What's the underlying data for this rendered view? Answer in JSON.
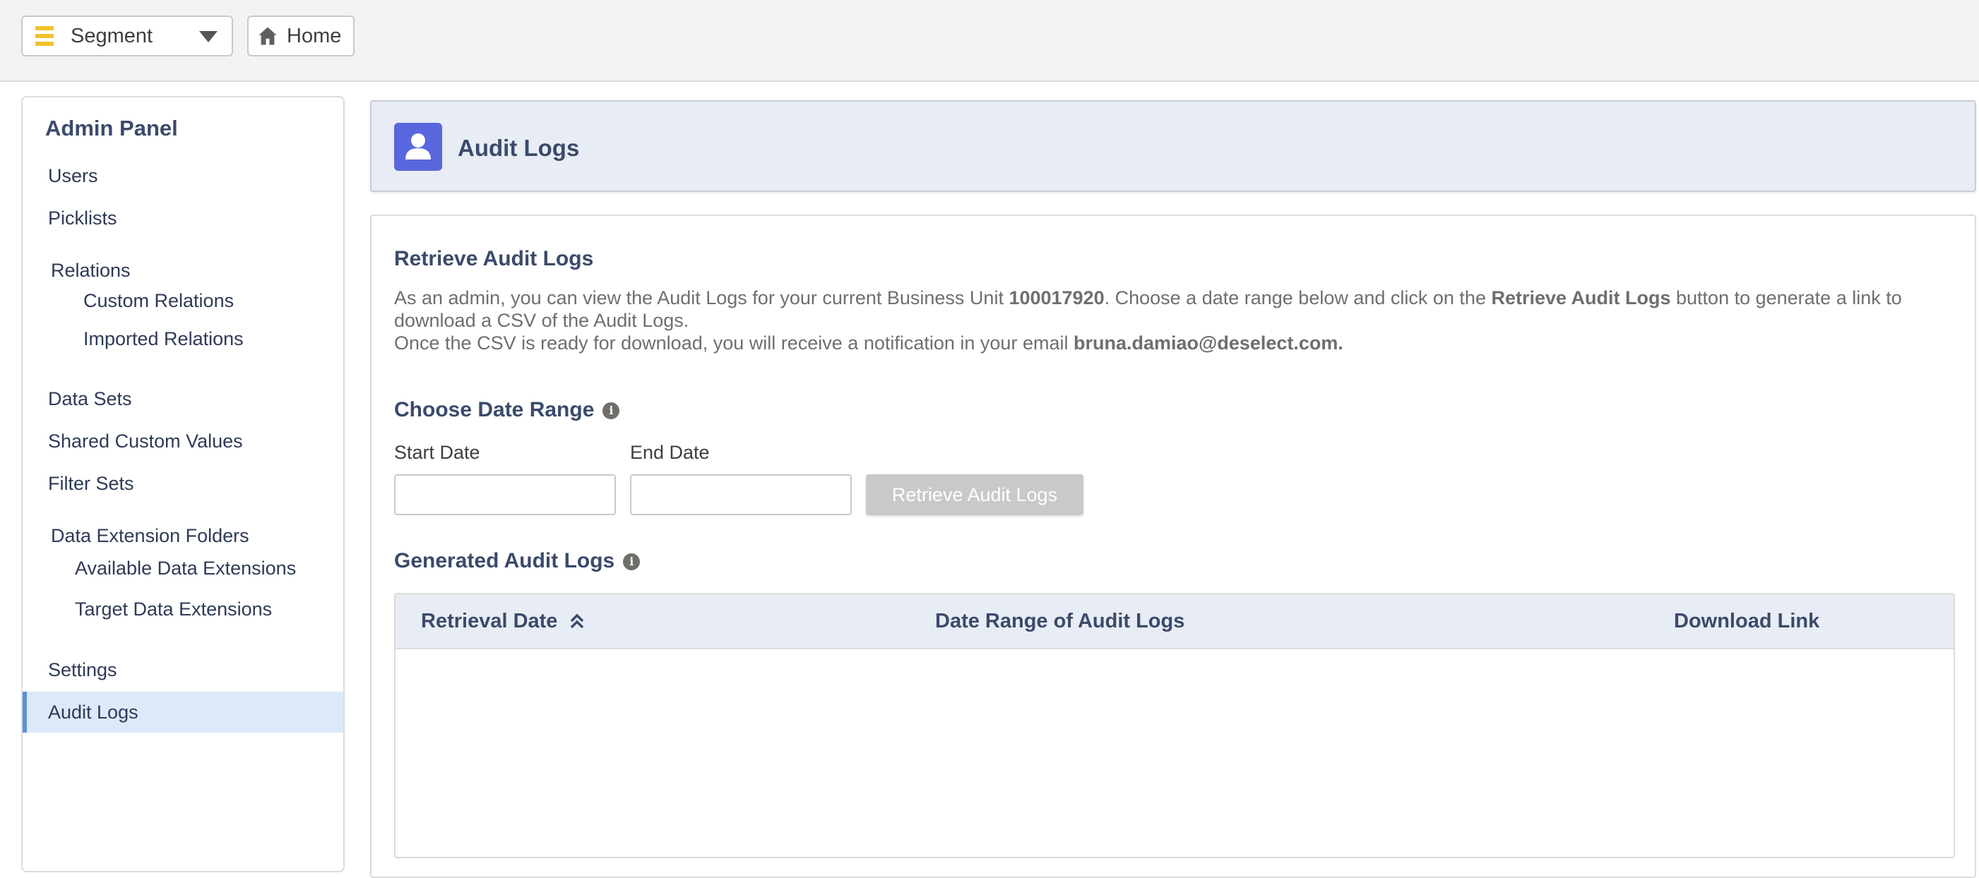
{
  "topbar": {
    "segment_label": "Segment",
    "home_label": "Home"
  },
  "sidebar": {
    "title": "Admin Panel",
    "items": [
      {
        "label": "Users"
      },
      {
        "label": "Picklists"
      },
      {
        "label": "Relations"
      },
      {
        "label": "Custom Relations"
      },
      {
        "label": "Imported Relations"
      },
      {
        "label": "Data Sets"
      },
      {
        "label": "Shared Custom Values"
      },
      {
        "label": "Filter Sets"
      },
      {
        "label": "Data Extension Folders"
      },
      {
        "label": "Available Data Extensions"
      },
      {
        "label": "Target Data Extensions"
      },
      {
        "label": "Settings"
      },
      {
        "label": "Audit Logs"
      }
    ]
  },
  "header": {
    "title": "Audit Logs",
    "icon": "user-icon"
  },
  "content": {
    "retrieve_title": "Retrieve Audit Logs",
    "desc_1": "As an admin, you can view the Audit Logs for your current Business Unit ",
    "business_unit": "100017920",
    "desc_2": ". Choose a date range below and click on the ",
    "button_ref": "Retrieve Audit Logs",
    "desc_3": " button to generate a link to download a CSV of the Audit Logs.",
    "desc_4": "Once the CSV is ready for download, you will receive a notification in your email ",
    "email": "bruna.damiao@deselect.com.",
    "date_range_title": "Choose Date Range",
    "start_label": "Start Date",
    "start_value": "",
    "end_label": "End Date",
    "end_value": "",
    "retrieve_button": "Retrieve Audit Logs",
    "generated_title": "Generated Audit Logs",
    "table_headers": [
      "Retrieval Date",
      "Date Range of Audit Logs",
      "Download Link"
    ]
  },
  "colors": {
    "accent": "#5a91d8",
    "header_icon_bg": "#5867dd",
    "segment_icon": "#f2c12e",
    "disabled_button": "#c9c9c9"
  }
}
